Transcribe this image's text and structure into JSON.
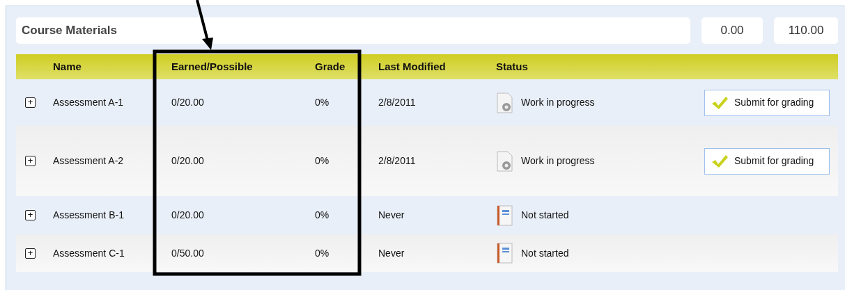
{
  "section": {
    "title": "Course Materials",
    "earned_total": "0.00",
    "possible_total": "110.00"
  },
  "columns": [
    "Name",
    "Earned/Possible",
    "Grade",
    "Last Modified",
    "Status"
  ],
  "rows": [
    {
      "name": "Assessment A-1",
      "expand": "+",
      "earned": "0/20.00",
      "grade": "0%",
      "modified": "2/8/2011",
      "kind": "in_progress",
      "status": "Work in progress",
      "action": "Submit for grading"
    },
    {
      "name": "Assessment A-2",
      "expand": "+",
      "earned": "0/20.00",
      "grade": "0%",
      "modified": "2/8/2011",
      "kind": "in_progress",
      "status": "Work in progress",
      "action": "Submit for grading"
    },
    {
      "name": "Assessment B-1",
      "expand": "+",
      "earned": "0/20.00",
      "grade": "0%",
      "modified": "Never",
      "kind": "not_started",
      "status": "Not started"
    },
    {
      "name": "Assessment C-1",
      "expand": "+",
      "earned": "0/50.00",
      "grade": "0%",
      "modified": "Never",
      "kind": "not_started",
      "status": "Not started"
    }
  ]
}
